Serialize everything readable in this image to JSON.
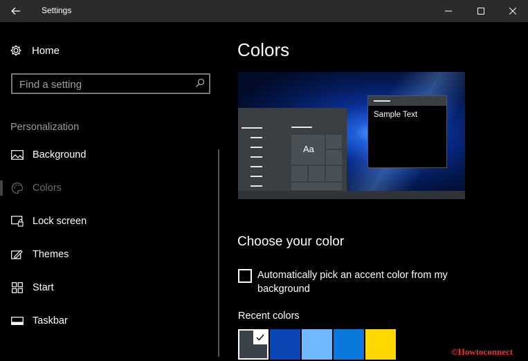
{
  "window": {
    "title": "Settings"
  },
  "nav": {
    "home_label": "Home",
    "search_placeholder": "Find a setting",
    "section_label": "Personalization",
    "items": [
      {
        "label": "Background",
        "icon": "picture-icon"
      },
      {
        "label": "Colors",
        "icon": "palette-icon",
        "active": true
      },
      {
        "label": "Lock screen",
        "icon": "lock-screen-icon"
      },
      {
        "label": "Themes",
        "icon": "themes-icon"
      },
      {
        "label": "Start",
        "icon": "start-icon"
      },
      {
        "label": "Taskbar",
        "icon": "taskbar-icon"
      }
    ]
  },
  "content": {
    "title": "Colors",
    "preview": {
      "tile_label": "Aa",
      "sample_text": "Sample Text"
    },
    "choose_heading": "Choose your color",
    "auto_pick_label": "Automatically pick an accent color from my background",
    "auto_pick_checked": false,
    "recent_label": "Recent colors",
    "recent_colors": [
      {
        "color": "#3a4148",
        "selected": true
      },
      {
        "color": "#0a46b4"
      },
      {
        "color": "#70b8ff"
      },
      {
        "color": "#0a78dc"
      },
      {
        "color": "#ffd800"
      }
    ]
  },
  "watermark": "©Howtoconnect"
}
